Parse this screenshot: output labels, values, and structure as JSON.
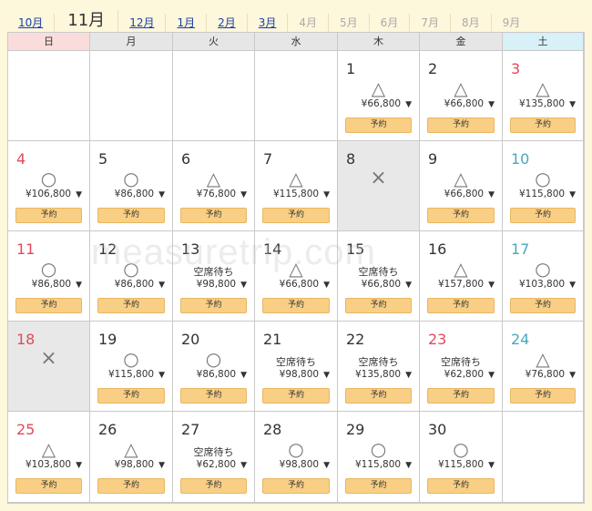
{
  "months": [
    {
      "label": "10月",
      "state": "link"
    },
    {
      "label": "11月",
      "state": "current"
    },
    {
      "label": "12月",
      "state": "link"
    },
    {
      "label": "1月",
      "state": "link"
    },
    {
      "label": "2月",
      "state": "link"
    },
    {
      "label": "3月",
      "state": "link"
    },
    {
      "label": "4月",
      "state": "disabled"
    },
    {
      "label": "5月",
      "state": "disabled"
    },
    {
      "label": "6月",
      "state": "disabled"
    },
    {
      "label": "7月",
      "state": "disabled"
    },
    {
      "label": "8月",
      "state": "disabled"
    },
    {
      "label": "9月",
      "state": "disabled"
    }
  ],
  "weekdays": [
    "日",
    "月",
    "火",
    "水",
    "木",
    "金",
    "土"
  ],
  "button_label": "予約",
  "days": [
    {
      "day": "1",
      "col": 4,
      "row": 0,
      "mark": "△",
      "price": "¥66,800"
    },
    {
      "day": "2",
      "col": 5,
      "row": 0,
      "mark": "△",
      "price": "¥66,800"
    },
    {
      "day": "3",
      "col": 6,
      "row": 0,
      "mark": "△",
      "price": "¥135,800",
      "holiday": true
    },
    {
      "day": "4",
      "col": 0,
      "row": 1,
      "mark": "○",
      "price": "¥106,800"
    },
    {
      "day": "5",
      "col": 1,
      "row": 1,
      "mark": "○",
      "price": "¥86,800"
    },
    {
      "day": "6",
      "col": 2,
      "row": 1,
      "mark": "△",
      "price": "¥76,800"
    },
    {
      "day": "7",
      "col": 3,
      "row": 1,
      "mark": "△",
      "price": "¥115,800"
    },
    {
      "day": "8",
      "col": 4,
      "row": 1,
      "mark": "×",
      "closed": true
    },
    {
      "day": "9",
      "col": 5,
      "row": 1,
      "mark": "△",
      "price": "¥66,800"
    },
    {
      "day": "10",
      "col": 6,
      "row": 1,
      "mark": "○",
      "price": "¥115,800"
    },
    {
      "day": "11",
      "col": 0,
      "row": 2,
      "mark": "○",
      "price": "¥86,800"
    },
    {
      "day": "12",
      "col": 1,
      "row": 2,
      "mark": "○",
      "price": "¥86,800"
    },
    {
      "day": "13",
      "col": 2,
      "row": 2,
      "mark": "空席待ち",
      "price": "¥98,800"
    },
    {
      "day": "14",
      "col": 3,
      "row": 2,
      "mark": "△",
      "price": "¥66,800"
    },
    {
      "day": "15",
      "col": 4,
      "row": 2,
      "mark": "空席待ち",
      "price": "¥66,800"
    },
    {
      "day": "16",
      "col": 5,
      "row": 2,
      "mark": "△",
      "price": "¥157,800"
    },
    {
      "day": "17",
      "col": 6,
      "row": 2,
      "mark": "○",
      "price": "¥103,800"
    },
    {
      "day": "18",
      "col": 0,
      "row": 3,
      "mark": "×",
      "closed": true
    },
    {
      "day": "19",
      "col": 1,
      "row": 3,
      "mark": "○",
      "price": "¥115,800"
    },
    {
      "day": "20",
      "col": 2,
      "row": 3,
      "mark": "○",
      "price": "¥86,800"
    },
    {
      "day": "21",
      "col": 3,
      "row": 3,
      "mark": "空席待ち",
      "price": "¥98,800"
    },
    {
      "day": "22",
      "col": 4,
      "row": 3,
      "mark": "空席待ち",
      "price": "¥135,800"
    },
    {
      "day": "23",
      "col": 5,
      "row": 3,
      "mark": "空席待ち",
      "price": "¥62,800",
      "holiday": true
    },
    {
      "day": "24",
      "col": 6,
      "row": 3,
      "mark": "△",
      "price": "¥76,800"
    },
    {
      "day": "25",
      "col": 0,
      "row": 4,
      "mark": "△",
      "price": "¥103,800"
    },
    {
      "day": "26",
      "col": 1,
      "row": 4,
      "mark": "△",
      "price": "¥98,800"
    },
    {
      "day": "27",
      "col": 2,
      "row": 4,
      "mark": "空席待ち",
      "price": "¥62,800"
    },
    {
      "day": "28",
      "col": 3,
      "row": 4,
      "mark": "○",
      "price": "¥98,800"
    },
    {
      "day": "29",
      "col": 4,
      "row": 4,
      "mark": "○",
      "price": "¥115,800"
    },
    {
      "day": "30",
      "col": 5,
      "row": 4,
      "mark": "○",
      "price": "¥115,800"
    }
  ],
  "watermark": "measuretrip.com"
}
